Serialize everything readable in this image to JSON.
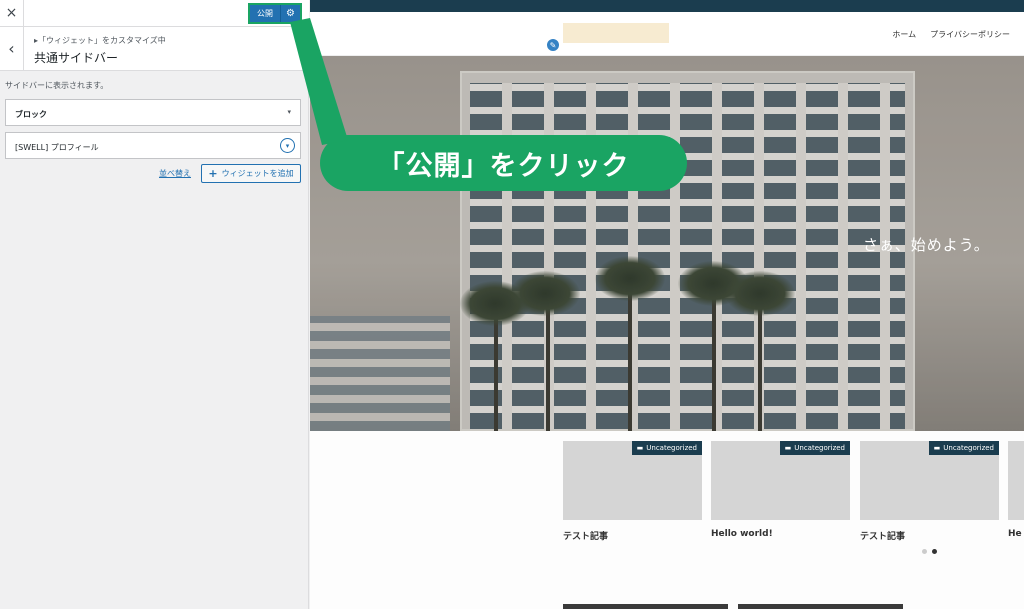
{
  "topbar": {
    "close_icon": "×",
    "publish_label": "公開",
    "gear_icon": "⚙"
  },
  "section": {
    "back_icon": "‹",
    "breadcrumb": "▸「ウィジェット」をカスタマイズ中",
    "title": "共通サイドバー"
  },
  "sidebar": {
    "description": "サイドバーに表示されます。",
    "block_select": {
      "value": "ブロック",
      "arrow": "▾"
    },
    "widget": {
      "label": "[SWELL] プロフィール",
      "toggle_icon": "▾"
    },
    "reorder_label": "並べ替え",
    "add_widget": {
      "icon": "+",
      "label": "ウィジェットを追加"
    }
  },
  "preview": {
    "edit_icon": "✎",
    "nav": [
      "ホーム",
      "プライバシーポリシー"
    ],
    "hero_caption": "さぁ、始めよう。",
    "callout": "「公開」をクリック",
    "cards": [
      {
        "category": "Uncategorized",
        "title": "テスト記事"
      },
      {
        "category": "Uncategorized",
        "title": "Hello world!"
      },
      {
        "category": "Uncategorized",
        "title": "テスト記事"
      },
      {
        "category": "",
        "title": "He"
      }
    ],
    "folder_icon": "▬"
  },
  "colors": {
    "publish": "#2271b1",
    "callout": "#1aa463",
    "site_dark": "#1b3d4f"
  }
}
